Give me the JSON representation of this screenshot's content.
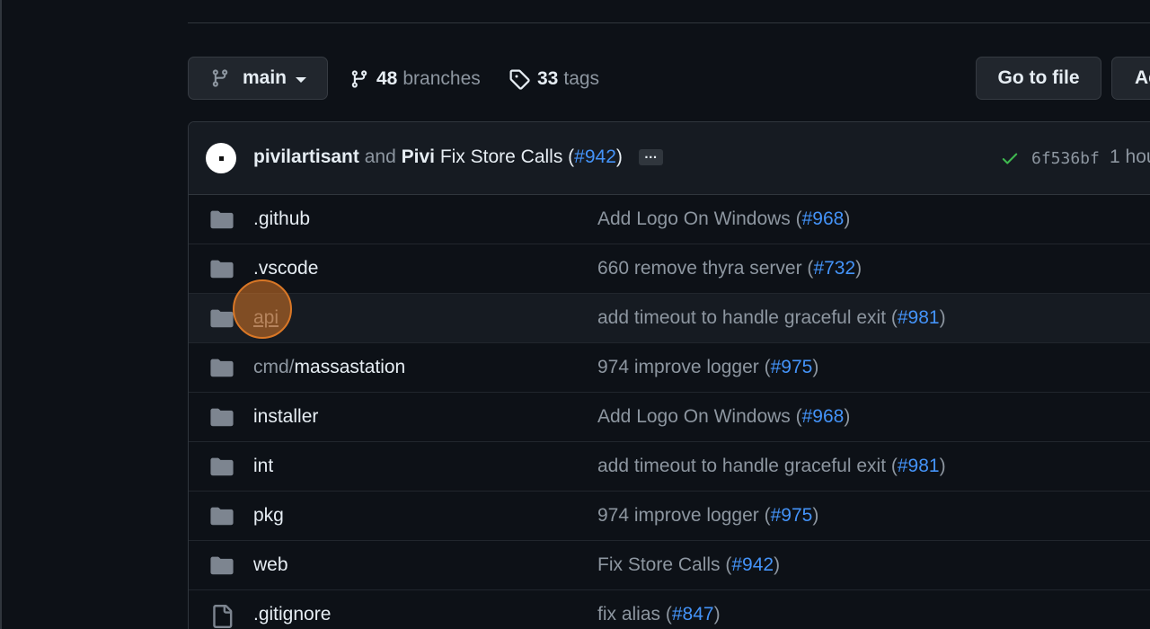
{
  "toolbar": {
    "branch_label": "main",
    "branches_count": "48",
    "branches_label": "branches",
    "tags_count": "33",
    "tags_label": "tags",
    "goto_file_label": "Go to file",
    "add_file_label": "Ac"
  },
  "commit": {
    "author1": "pivilartisant",
    "and_text": "and",
    "author2": "Pivi",
    "message": "Fix Store Calls (",
    "pr": "#942",
    "close_paren": ")",
    "ellipsis": "…",
    "sha": "6f536bf",
    "time": "1 hou"
  },
  "files": [
    {
      "type": "folder",
      "prefix": "",
      "name": ".github",
      "msg": "Add Logo On Windows (",
      "pr": "#968",
      "close": ")"
    },
    {
      "type": "folder",
      "prefix": "",
      "name": ".vscode",
      "msg": "660 remove thyra server (",
      "pr": "#732",
      "close": ")"
    },
    {
      "type": "folder",
      "prefix": "",
      "name": "api",
      "msg": "add timeout to handle graceful exit (",
      "pr": "#981",
      "close": ")"
    },
    {
      "type": "folder",
      "prefix": "cmd/",
      "name": "massastation",
      "msg": "974 improve logger (",
      "pr": "#975",
      "close": ")"
    },
    {
      "type": "folder",
      "prefix": "",
      "name": "installer",
      "msg": "Add Logo On Windows (",
      "pr": "#968",
      "close": ")"
    },
    {
      "type": "folder",
      "prefix": "",
      "name": "int",
      "msg": "add timeout to handle graceful exit (",
      "pr": "#981",
      "close": ")"
    },
    {
      "type": "folder",
      "prefix": "",
      "name": "pkg",
      "msg": "974 improve logger (",
      "pr": "#975",
      "close": ")"
    },
    {
      "type": "folder",
      "prefix": "",
      "name": "web",
      "msg": "Fix Store Calls (",
      "pr": "#942",
      "close": ")"
    },
    {
      "type": "file",
      "prefix": "",
      "name": ".gitignore",
      "msg": "fix alias (",
      "pr": "#847",
      "close": ")"
    }
  ],
  "icons": {
    "branch": "git-branch-icon",
    "tag": "tag-icon",
    "folder": "folder-icon",
    "file": "file-icon",
    "check": "check-icon"
  },
  "colors": {
    "background": "#0d1117",
    "link": "#4493f8",
    "folder": "#7d8590",
    "success": "#3fb950",
    "cursor": "#d97726"
  }
}
